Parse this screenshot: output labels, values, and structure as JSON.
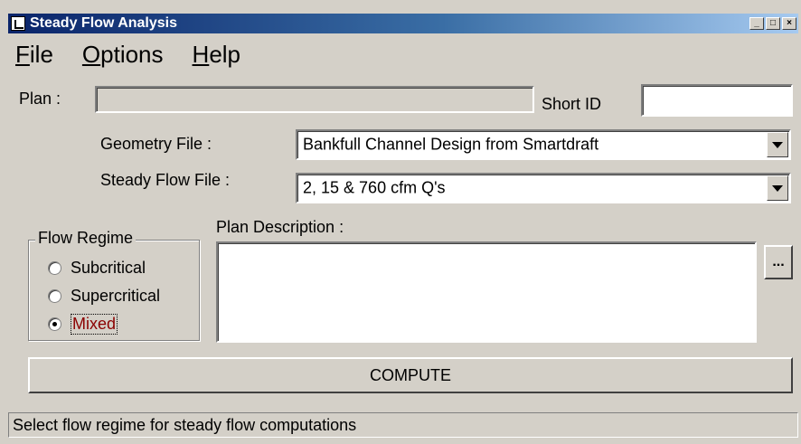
{
  "window": {
    "title": "Steady Flow Analysis",
    "controls": {
      "minimize": "_",
      "maximize": "□",
      "close": "×"
    }
  },
  "menu": {
    "items": [
      {
        "accel": "F",
        "rest": "ile"
      },
      {
        "accel": "O",
        "rest": "ptions"
      },
      {
        "accel": "H",
        "rest": "elp"
      }
    ]
  },
  "plan": {
    "label": "Plan :",
    "value": "",
    "short_id_label": "Short ID",
    "short_id_value": ""
  },
  "geometry": {
    "label": "Geometry File :",
    "selected": "Bankfull Channel Design from Smartdraft"
  },
  "steady_flow": {
    "label": "Steady Flow File :",
    "selected": "2, 15 & 760 cfm Q's"
  },
  "flow_regime": {
    "legend": "Flow Regime",
    "options": [
      {
        "label": "Subcritical",
        "checked": false
      },
      {
        "label": "Supercritical",
        "checked": false
      },
      {
        "label": "Mixed",
        "checked": true
      }
    ]
  },
  "description": {
    "label": "Plan Description :",
    "value": "",
    "browse_label": "..."
  },
  "compute": {
    "label": "COMPUTE"
  },
  "status": {
    "text": "Select flow regime for steady flow computations"
  }
}
